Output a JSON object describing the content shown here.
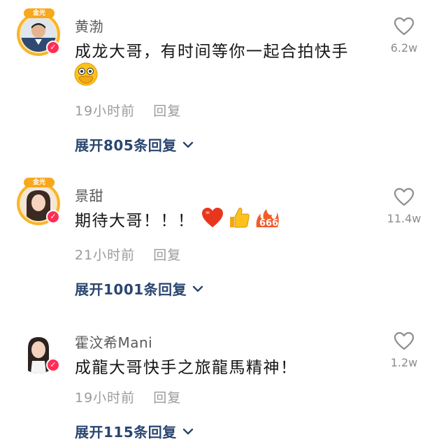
{
  "comments": [
    {
      "username": "黄渤",
      "text": "成龙大哥，有时间等你一起合拍快手",
      "time": "19小时前",
      "reply_label": "回复",
      "expand_label": "展开805条回复",
      "like_count": "6.2w",
      "avatar_badge": "金光",
      "emoji": [
        "face-with-hand-over-mouth"
      ]
    },
    {
      "username": "景甜",
      "text": "期待大哥！！！",
      "time": "21小时前",
      "reply_label": "回复",
      "expand_label": "展开1001条回复",
      "like_count": "11.4w",
      "avatar_badge": "金光",
      "emoji": [
        "red-heart",
        "thumbs-up",
        "666-fire"
      ]
    },
    {
      "username": "霍汶希Mani",
      "text": "成龍大哥快手之旅龍馬精神！",
      "time": "19小时前",
      "reply_label": "回复",
      "expand_label": "展开115条回复",
      "like_count": "1.2w",
      "emoji": []
    }
  ],
  "colors": {
    "accent_link": "#2a4670",
    "verified_badge": "#ff2d55",
    "avatar_ring": "#f7b52b"
  }
}
